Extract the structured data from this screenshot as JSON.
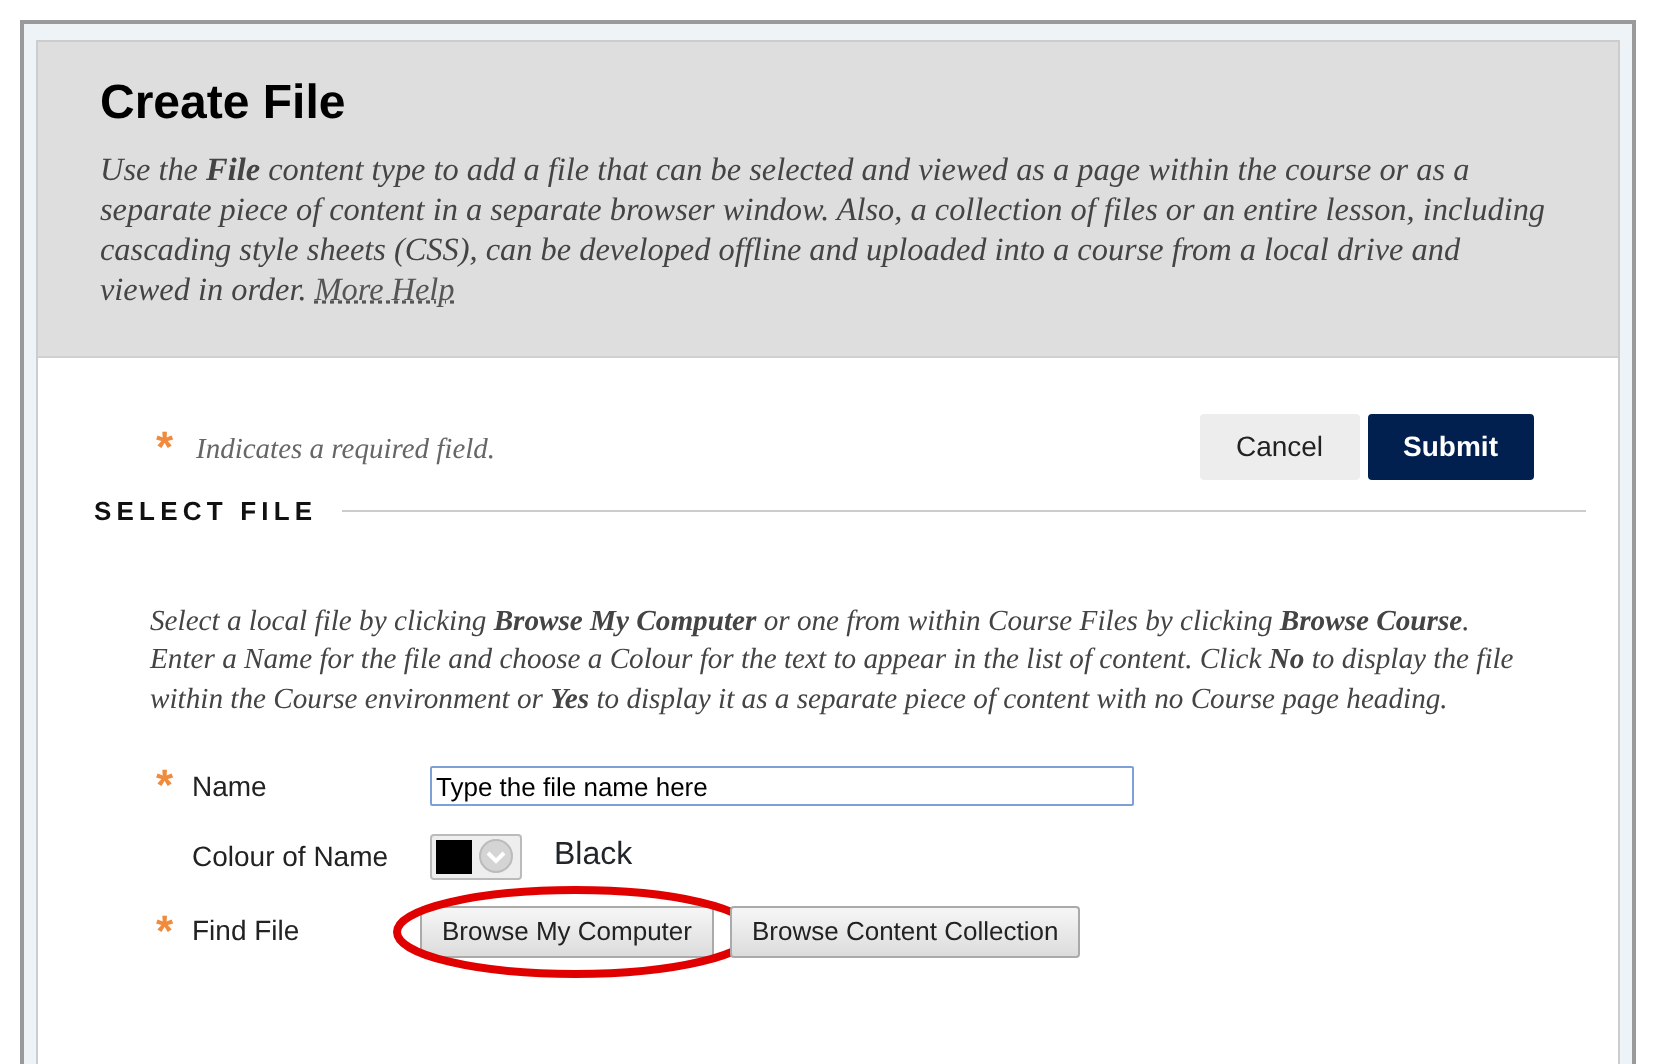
{
  "header": {
    "title": "Create File",
    "description": "Use the **File** content type to add a file that can be selected and viewed as a page within the course or as a separate piece of content in a separate browser window. Also, a collection of files or an entire lesson, including cascading style sheets (CSS), can be developed offline and uploaded into a course from a local drive and viewed in order.",
    "help_link": "More Help"
  },
  "required_note": {
    "icon": "*",
    "text": "Indicates a required field."
  },
  "actions": [
    {
      "label": "Cancel",
      "kind": "secondary"
    },
    {
      "label": "Submit",
      "kind": "primary"
    }
  ],
  "section": {
    "title": "SELECT FILE",
    "instructions": "Select a local file by clicking **Browse My Computer** or one from within Course Files by clicking **Browse Course**. Enter a Name for the file and choose a Colour for the text to appear in the list of content. Click **No** to display the file within the Course environment or **Yes** to display it as a separate piece of content with no Course page heading."
  },
  "fields": [
    {
      "kind": "text",
      "label": "Name",
      "required": true,
      "value": "Type the file name here"
    },
    {
      "kind": "color",
      "label": "Colour of Name",
      "required": false,
      "color": "#000000",
      "value": "Black"
    },
    {
      "kind": "buttons",
      "label": "Find File",
      "required": true,
      "buttons": [
        {
          "label": "Browse My Computer",
          "circled": true
        },
        {
          "label": "Browse Content Collection",
          "circled": false
        }
      ]
    }
  ]
}
